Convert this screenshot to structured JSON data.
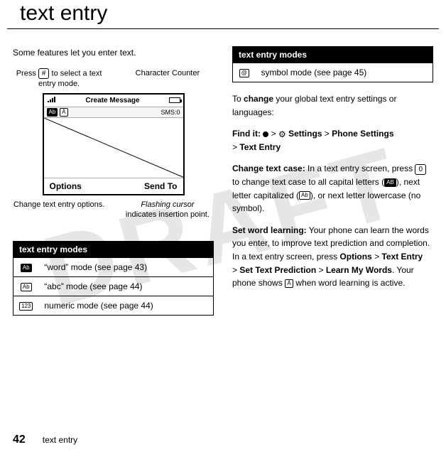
{
  "watermark": "DRAFT",
  "title": "text entry",
  "left": {
    "intro": "Some features let you enter text.",
    "callouts": {
      "press_to_select_prefix": "Press ",
      "press_to_select_suffix": " to select a text entry mode.",
      "press_key": "#",
      "character_counter": "Character Counter",
      "change_options": "Change text entry options.",
      "flashing_cursor": "Flashing cursor",
      "flashing_cursor_rest": "indicates insertion point."
    },
    "phone": {
      "title": "Create Message",
      "sms_counter": "SMS:0",
      "sub_icon1": "Ab",
      "sub_icon2": "Á",
      "soft_left": "Options",
      "soft_right": "Send To"
    },
    "modes": {
      "header": "text entry modes",
      "rows": [
        {
          "icon_text": "Ab",
          "icon_filled": true,
          "desc": "“word” mode (see page 43)"
        },
        {
          "icon_text": "Ab",
          "icon_filled": false,
          "desc": "“abc” mode (see page 44)"
        },
        {
          "icon_text": "123",
          "icon_filled": false,
          "desc": "numeric mode (see page 44)"
        }
      ]
    }
  },
  "right": {
    "modes": {
      "header": "text entry modes",
      "rows": [
        {
          "icon_text": "@",
          "icon_filled": false,
          "desc": "symbol mode (see page 45)"
        }
      ]
    },
    "change_intro_prefix": "To ",
    "change_intro_bold": "change",
    "change_intro_suffix": " your global text entry settings or languages:",
    "find_it_label": "Find it:",
    "nav_sep": " > ",
    "nav_settings": "Settings",
    "nav_phone_settings": "Phone Settings",
    "nav_text_entry": "Text Entry",
    "change_case_label": "Change text case:",
    "change_case_text_1": " In a text entry screen, press ",
    "change_case_key": "0",
    "change_case_text_2": " to change text case to all capital letters (",
    "change_case_icon_caps": "AB",
    "change_case_text_3": "), next letter capitalized (",
    "change_case_icon_cap": "Ab",
    "change_case_text_4": "), or next letter lowercase (no symbol).",
    "word_learning_label": "Set word learning:",
    "word_learning_text_1": " Your phone can learn the words you enter, to improve text prediction and completion. In a text entry screen, press ",
    "word_learning_options": "Options",
    "word_learning_text_entry": "Text Entry",
    "word_learning_set_pred": "Set Text Prediction",
    "word_learning_learn": "Learn My Words",
    "word_learning_text_2": ". Your phone shows ",
    "word_learning_icon": "Á",
    "word_learning_text_3": " when word learning is active."
  },
  "footer": {
    "page": "42",
    "section": "text entry"
  }
}
